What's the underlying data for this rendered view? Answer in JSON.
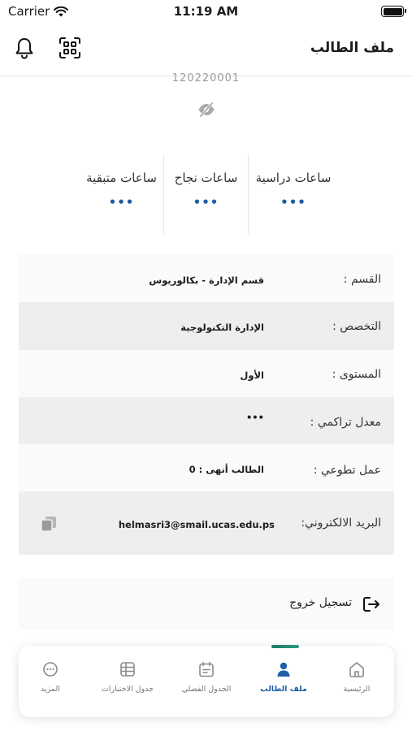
{
  "status_bar": {
    "carrier": "Carrier",
    "time": "11:19 AM"
  },
  "header": {
    "title": "ملف الطالب",
    "icons": [
      "bell-icon",
      "qr-scan-icon"
    ]
  },
  "student": {
    "id": "120220001"
  },
  "stats": [
    {
      "label": "ساعات دراسية",
      "value": "•••"
    },
    {
      "label": "ساعات نجاح",
      "value": "•••"
    },
    {
      "label": "ساعات متبقية",
      "value": "•••"
    }
  ],
  "info": {
    "department": {
      "label": "القسم :",
      "value": "قسم الإدارة - بكالوريوس"
    },
    "major": {
      "label": "التخصص :",
      "value": "الإدارة التكنولوجية"
    },
    "level": {
      "label": "المستوى :",
      "value": "الأول"
    },
    "gpa": {
      "label": "معدل تراكمي :",
      "value": "•••"
    },
    "volunteer": {
      "label": "عمل تطوعي :",
      "value": "الطالب أنهى : 0"
    },
    "email": {
      "label": "البريد الالكتروني:",
      "value": "helmasri3@smail.ucas.edu.ps"
    }
  },
  "logout": {
    "label": "تسجيل خروج"
  },
  "tabs": [
    {
      "label": "الرئيسية",
      "icon": "home-icon"
    },
    {
      "label": "ملف الطالب",
      "icon": "person-icon",
      "active": true
    },
    {
      "label": "الجدول الفصلي",
      "icon": "calendar-icon"
    },
    {
      "label": "جدول الاختبارات",
      "icon": "table-icon"
    },
    {
      "label": "المزيد",
      "icon": "more-icon"
    }
  ],
  "colors": {
    "accent": "#1f5fa8",
    "indicator": "#2e9a80",
    "row_grey": "#eeeeee",
    "row_light": "#fafafa"
  }
}
